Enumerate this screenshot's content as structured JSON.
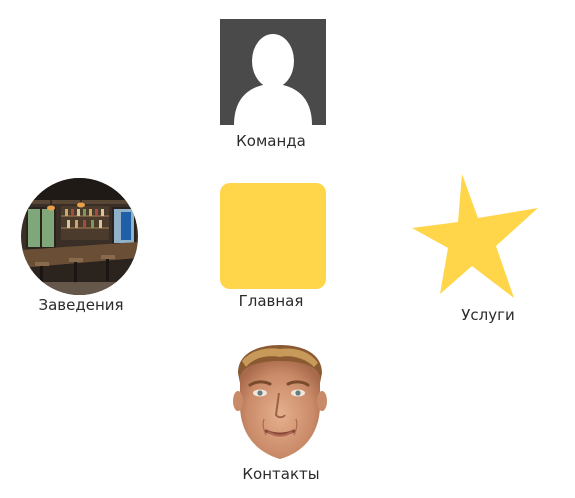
{
  "menu": {
    "team": {
      "label": "Команда",
      "icon": "user-placeholder-icon"
    },
    "venues": {
      "label": "Заведения",
      "icon": "venue-photo-icon"
    },
    "home": {
      "label": "Главная",
      "icon": "square-icon"
    },
    "services": {
      "label": "Услуги",
      "icon": "star-icon"
    },
    "contacts": {
      "label": "Контакты",
      "icon": "face-portrait-icon"
    }
  },
  "colors": {
    "accent_yellow": "#FFD54A",
    "placeholder_gray": "#4a4a4a",
    "text": "#2b2b2b"
  }
}
